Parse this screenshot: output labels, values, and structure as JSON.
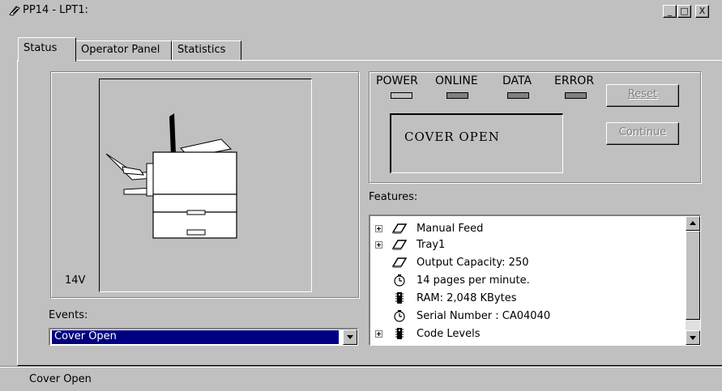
{
  "window": {
    "title": "PP14 - LPT1:",
    "buttons": [
      "_",
      "□",
      "X"
    ]
  },
  "tabs": [
    {
      "label": "Status",
      "active": true
    },
    {
      "label": "Operator Panel",
      "active": false
    },
    {
      "label": "Statistics",
      "active": false
    }
  ],
  "printer_image": {
    "model_label": "14V"
  },
  "indicators": [
    {
      "label": "POWER",
      "on": false
    },
    {
      "label": "ONLINE",
      "on": true
    },
    {
      "label": "DATA",
      "on": true
    },
    {
      "label": "ERROR",
      "on": true
    }
  ],
  "display": {
    "text": "COVER OPEN"
  },
  "buttons": {
    "reset": {
      "label": "Reset",
      "enabled": false
    },
    "continue": {
      "label": "Continue",
      "enabled": false
    }
  },
  "features": {
    "label": "Features:",
    "items": [
      {
        "text": "Manual Feed",
        "icon": "paper-tray-icon",
        "expandable": true
      },
      {
        "text": "Tray1",
        "icon": "paper-tray-icon",
        "expandable": true
      },
      {
        "text": "Output Capacity: 250",
        "icon": "paper-tray-icon",
        "expandable": false
      },
      {
        "text": "14 pages per minute.",
        "icon": "stopwatch-icon",
        "expandable": false
      },
      {
        "text": "RAM:  2,048 KBytes",
        "icon": "memory-chip-icon",
        "expandable": false
      },
      {
        "text": "Serial Number : CA04040",
        "icon": "stopwatch-icon",
        "expandable": false
      },
      {
        "text": "Code Levels",
        "icon": "memory-chip-icon",
        "expandable": true
      }
    ]
  },
  "events": {
    "label": "Events:",
    "selected": "Cover Open"
  },
  "statusbar": {
    "text": "Cover Open"
  }
}
